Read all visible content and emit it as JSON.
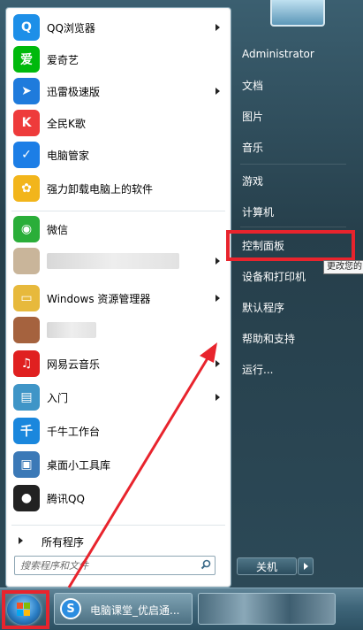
{
  "programs": [
    {
      "label": "QQ浏览器",
      "icon": "qq-browser-icon",
      "color": "#1d8fe8",
      "glyph": "Q",
      "arrow": true
    },
    {
      "label": "爱奇艺",
      "icon": "iqiyi-icon",
      "color": "#00b90c",
      "glyph": "爱",
      "arrow": false
    },
    {
      "label": "迅雷极速版",
      "icon": "xunlei-icon",
      "color": "#1f7bdc",
      "glyph": "➤",
      "arrow": true
    },
    {
      "label": "全民K歌",
      "icon": "kge-icon",
      "color": "#ee3b3b",
      "glyph": "K",
      "arrow": false
    },
    {
      "label": "电脑管家",
      "icon": "pc-manager-icon",
      "color": "#1c7ee6",
      "glyph": "✓",
      "arrow": false
    },
    {
      "label": "强力卸载电脑上的软件",
      "icon": "uninstall-icon",
      "color": "#f2b51b",
      "glyph": "✿",
      "arrow": false
    },
    {
      "label": "微信",
      "icon": "wechat-icon",
      "color": "#2aae39",
      "glyph": "◉",
      "arrow": false
    },
    {
      "label": "",
      "icon": "blurred-app-icon",
      "color": "#c9b59a",
      "glyph": "",
      "arrow": true
    },
    {
      "label": "Windows 资源管理器",
      "icon": "explorer-icon",
      "color": "#e7b93c",
      "glyph": "▭",
      "arrow": true
    },
    {
      "label": "",
      "icon": "blurred-app-icon-2",
      "color": "#a5623e",
      "glyph": "",
      "arrow": false
    },
    {
      "label": "网易云音乐",
      "icon": "netease-music-icon",
      "color": "#e02020",
      "glyph": "♫",
      "arrow": true
    },
    {
      "label": "入门",
      "icon": "getting-started-icon",
      "color": "#3f95c7",
      "glyph": "▤",
      "arrow": true
    },
    {
      "label": "千牛工作台",
      "icon": "qianniu-icon",
      "color": "#1a87dd",
      "glyph": "千",
      "arrow": false
    },
    {
      "label": "桌面小工具库",
      "icon": "gadgets-icon",
      "color": "#3b79b7",
      "glyph": "▣",
      "arrow": false
    },
    {
      "label": "腾讯QQ",
      "icon": "qq-penguin-icon",
      "color": "#222222",
      "glyph": "●",
      "arrow": false
    }
  ],
  "all_programs": "所有程序",
  "search": {
    "placeholder": "搜索程序和文件"
  },
  "right_menu": [
    "Administrator",
    "文档",
    "图片",
    "音乐",
    "游戏",
    "计算机",
    "控制面板",
    "设备和打印机",
    "默认程序",
    "帮助和支持",
    "运行..."
  ],
  "tooltip": "更改您的",
  "shutdown": "关机",
  "taskbar": {
    "task1": "电脑课堂_优启通..."
  },
  "colors": {
    "annotation_red": "#e8242d"
  }
}
